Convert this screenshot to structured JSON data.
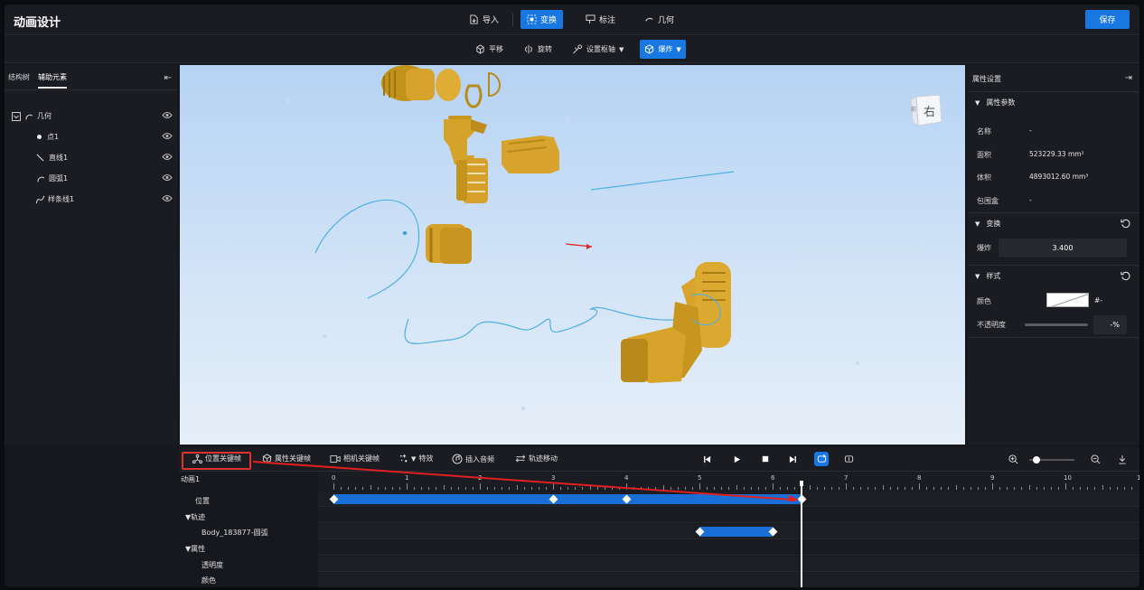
{
  "app": {
    "title": "动画设计",
    "save_label": "保存"
  },
  "mode_tabs": [
    {
      "label": "导入",
      "icon": "import-icon",
      "active": false
    },
    {
      "label": "变换",
      "icon": "transform-icon",
      "active": true
    },
    {
      "label": "标注",
      "icon": "annotate-icon",
      "active": false
    },
    {
      "label": "几何",
      "icon": "geometry-icon",
      "active": false
    }
  ],
  "tools": [
    {
      "label": "平移",
      "icon": "move-icon",
      "active": false,
      "dropdown": false
    },
    {
      "label": "旋转",
      "icon": "rotate-icon",
      "active": false,
      "dropdown": false
    },
    {
      "label": "设置枢轴",
      "icon": "pivot-icon",
      "active": false,
      "dropdown": true
    },
    {
      "label": "爆炸",
      "icon": "explode-icon",
      "active": true,
      "dropdown": true
    }
  ],
  "left_panel": {
    "tabs": [
      {
        "label": "结构树",
        "active": false
      },
      {
        "label": "辅助元素",
        "active": true
      }
    ],
    "tree": [
      {
        "label": "几何",
        "icon": "arc-icon",
        "level": 0,
        "expanded": true
      },
      {
        "label": "点1",
        "icon": "point-icon",
        "level": 1
      },
      {
        "label": "直线1",
        "icon": "line-icon",
        "level": 1
      },
      {
        "label": "圆弧1",
        "icon": "arc-icon",
        "level": 1
      },
      {
        "label": "样条线1",
        "icon": "spline-icon",
        "level": 1
      }
    ]
  },
  "viewport": {
    "view_cube": {
      "face_label": "右",
      "side_label": "前"
    }
  },
  "right_panel": {
    "title": "属性设置",
    "sections": {
      "params": {
        "label": "属性参数"
      },
      "transform": {
        "label": "变换"
      },
      "style": {
        "label": "样式"
      }
    },
    "params": [
      {
        "label": "名称",
        "value": "-"
      },
      {
        "label": "面积",
        "value": "523229.33 mm²"
      },
      {
        "label": "体积",
        "value": "4893012.60 mm³"
      },
      {
        "label": "包围盒",
        "value": "-"
      }
    ],
    "transform": {
      "label": "爆炸",
      "value": "3.400"
    },
    "style": {
      "color_label": "颜色",
      "color_value": "#-",
      "opacity_label": "不透明度",
      "opacity_value": "-%"
    }
  },
  "timeline": {
    "toolbar": [
      {
        "label": "位置关键帧",
        "icon": "position-keyframe-icon"
      },
      {
        "label": "属性关键帧",
        "icon": "property-keyframe-icon"
      },
      {
        "label": "相机关键帧",
        "icon": "camera-keyframe-icon"
      },
      {
        "label": "特效",
        "icon": "effects-icon"
      },
      {
        "label": "插入音频",
        "icon": "audio-icon"
      },
      {
        "label": "轨迹移动",
        "icon": "track-move-icon"
      }
    ],
    "animation_name": "动画1",
    "ruler_labels": [
      "0",
      "1",
      "2",
      "3",
      "4",
      "5",
      "6",
      "7",
      "8",
      "9",
      "10",
      "1"
    ],
    "tracks": [
      {
        "label": "位置",
        "type": "item",
        "bars": [
          [
            0,
            6.4
          ]
        ],
        "keyframes": [
          0,
          3,
          4,
          6.4
        ]
      },
      {
        "label": "▼轨迹",
        "type": "group",
        "bars": [],
        "keyframes": []
      },
      {
        "label": "Body_183877-圆弧",
        "type": "item",
        "bars": [
          [
            5,
            6
          ]
        ],
        "keyframes": [
          5,
          6
        ]
      },
      {
        "label": "▼属性",
        "type": "group",
        "bars": [],
        "keyframes": []
      },
      {
        "label": "透明度",
        "type": "item",
        "bars": [],
        "keyframes": []
      },
      {
        "label": "颜色",
        "type": "item",
        "bars": [],
        "keyframes": []
      }
    ],
    "playhead_time": 6.4,
    "zoom_level": 0.15
  }
}
